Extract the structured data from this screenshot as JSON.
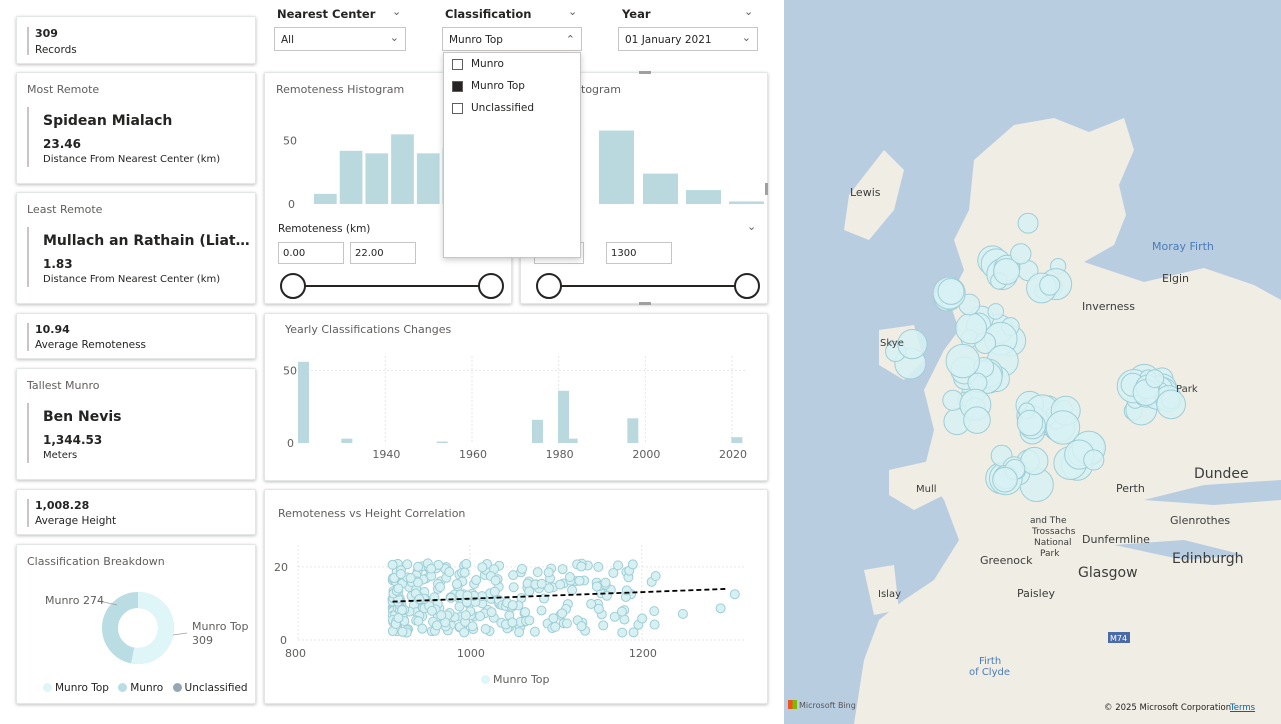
{
  "kpis": {
    "records": {
      "value": "309",
      "label": "Records"
    },
    "avg_remoteness": {
      "value": "10.94",
      "label": "Average Remoteness"
    },
    "avg_height": {
      "value": "1,008.28",
      "label": "Average Height"
    }
  },
  "most_remote": {
    "title": "Most Remote",
    "name": "Spidean Mialach",
    "value": "23.46",
    "label": "Distance From Nearest Center (km)"
  },
  "least_remote": {
    "title": "Least Remote",
    "name": "Mullach an Rathain (Liatha...",
    "value": "1.83",
    "label": "Distance From Nearest Center (km)"
  },
  "tallest": {
    "title": "Tallest Munro",
    "name": "Ben Nevis",
    "value": "1,344.53",
    "label": "Meters"
  },
  "slicers": {
    "nearest_center": {
      "title": "Nearest Center",
      "value": "All"
    },
    "classification": {
      "title": "Classification",
      "value": "Munro Top",
      "options": [
        {
          "label": "Munro",
          "checked": false
        },
        {
          "label": "Munro Top",
          "checked": true
        },
        {
          "label": "Unclassified",
          "checked": false
        }
      ]
    },
    "year": {
      "title": "Year",
      "value": "01 January 2021"
    }
  },
  "remoteness_hist": {
    "title": "Remoteness Histogram",
    "filter_label": "Remoteness (km)",
    "min": "0.00",
    "max": "22.00"
  },
  "height_hist": {
    "title_visible": "togram",
    "max": "1300"
  },
  "yearly": {
    "title": "Yearly Classifications Changes"
  },
  "scatter": {
    "title": "Remoteness vs Height Correlation",
    "legend": "Munro Top"
  },
  "donut": {
    "title": "Classification Breakdown",
    "label_munro": "Munro 274",
    "label_top_a": "Munro Top",
    "label_top_b": "309",
    "legend": [
      "Munro Top",
      "Munro",
      "Unclassified"
    ]
  },
  "map": {
    "labels": [
      "Lewis",
      "Moray Firth",
      "Elgin",
      "Inverness",
      "Skye",
      "Park",
      "Dundee",
      "Perth",
      "Mull",
      "Glenrothes",
      "Dunfermline",
      "Edinburgh",
      "Greenock",
      "Glasgow",
      "Islay",
      "Paisley",
      "Firth",
      "of Clyde",
      "M74",
      "Trossachs",
      "National",
      "Park",
      "and The"
    ],
    "attribution": "© 2025 Microsoft Corporation",
    "terms": "Terms",
    "brand": "Microsoft Bing"
  },
  "colors": {
    "bar": "#b9d9df",
    "point_fill": "#d7f1f3",
    "point_stroke": "#9fcdd6",
    "munro": "#b9dde2",
    "unclassified": "#94a7b3",
    "munro_top": "#dff6f8"
  },
  "chart_data": [
    {
      "type": "bar",
      "title": "Remoteness Histogram",
      "ylabel": "",
      "xlabel": "",
      "ylim": [
        0,
        60
      ],
      "yticks": [
        0,
        50
      ],
      "values": [
        8,
        42,
        40,
        55,
        40,
        44,
        26
      ]
    },
    {
      "type": "bar",
      "title": "Height Histogram",
      "ylim": [
        0,
        60
      ],
      "values": [
        58,
        24,
        11,
        2
      ]
    },
    {
      "type": "bar",
      "title": "Yearly Classifications Changes",
      "xlim": [
        1921,
        2023
      ],
      "ylim": [
        0,
        60
      ],
      "yticks": [
        0,
        50
      ],
      "xticks": [
        1940,
        1960,
        1980,
        2000,
        2020
      ],
      "x": [
        1921,
        1931,
        1953,
        1975,
        1981,
        1983,
        1997,
        2021
      ],
      "values": [
        56,
        3,
        1,
        16,
        36,
        3,
        17,
        4
      ]
    },
    {
      "type": "scatter",
      "title": "Remoteness vs Height Correlation",
      "xlim": [
        800,
        1320
      ],
      "ylim": [
        0,
        26
      ],
      "xticks": [
        800,
        1000,
        1200
      ],
      "yticks": [
        0,
        20
      ],
      "trend": [
        [
          910,
          10.5
        ],
        [
          1300,
          14
        ]
      ]
    },
    {
      "type": "pie",
      "title": "Classification Breakdown",
      "labels": [
        "Munro Top",
        "Munro"
      ],
      "values": [
        309,
        274
      ]
    }
  ]
}
